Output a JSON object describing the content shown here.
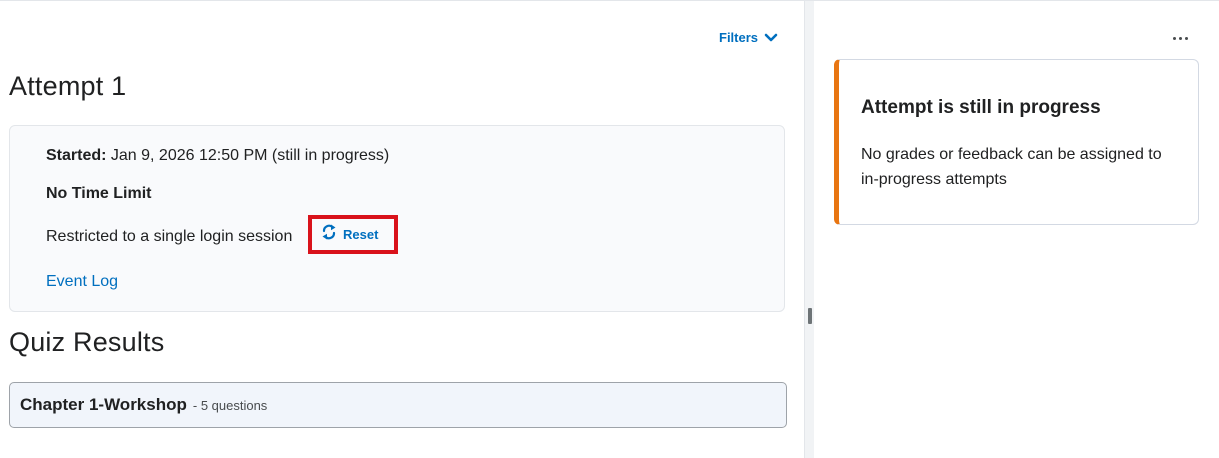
{
  "header": {
    "filters_label": "Filters"
  },
  "attempt": {
    "heading": "Attempt 1",
    "started_label": "Started:",
    "started_value": " Jan 9, 2026 12:50 PM (still in progress)",
    "time_limit": "No Time Limit",
    "restriction_text": "Restricted to a single login session",
    "reset_label": "Reset",
    "event_log_label": "Event Log"
  },
  "results": {
    "heading": "Quiz Results",
    "quiz_title": "Chapter 1-Workshop",
    "quiz_meta": "- 5 questions"
  },
  "sidebar": {
    "alert_title": "Attempt is still in progress",
    "alert_body": "No grades or feedback can be assigned to in-progress attempts"
  },
  "icons": {
    "filters": "chevron-down-icon",
    "reset": "reset-icon",
    "more": "more-options-icon"
  },
  "colors": {
    "link": "#006fbf",
    "alert_accent": "#e87511",
    "highlight_box": "#d9121b"
  }
}
